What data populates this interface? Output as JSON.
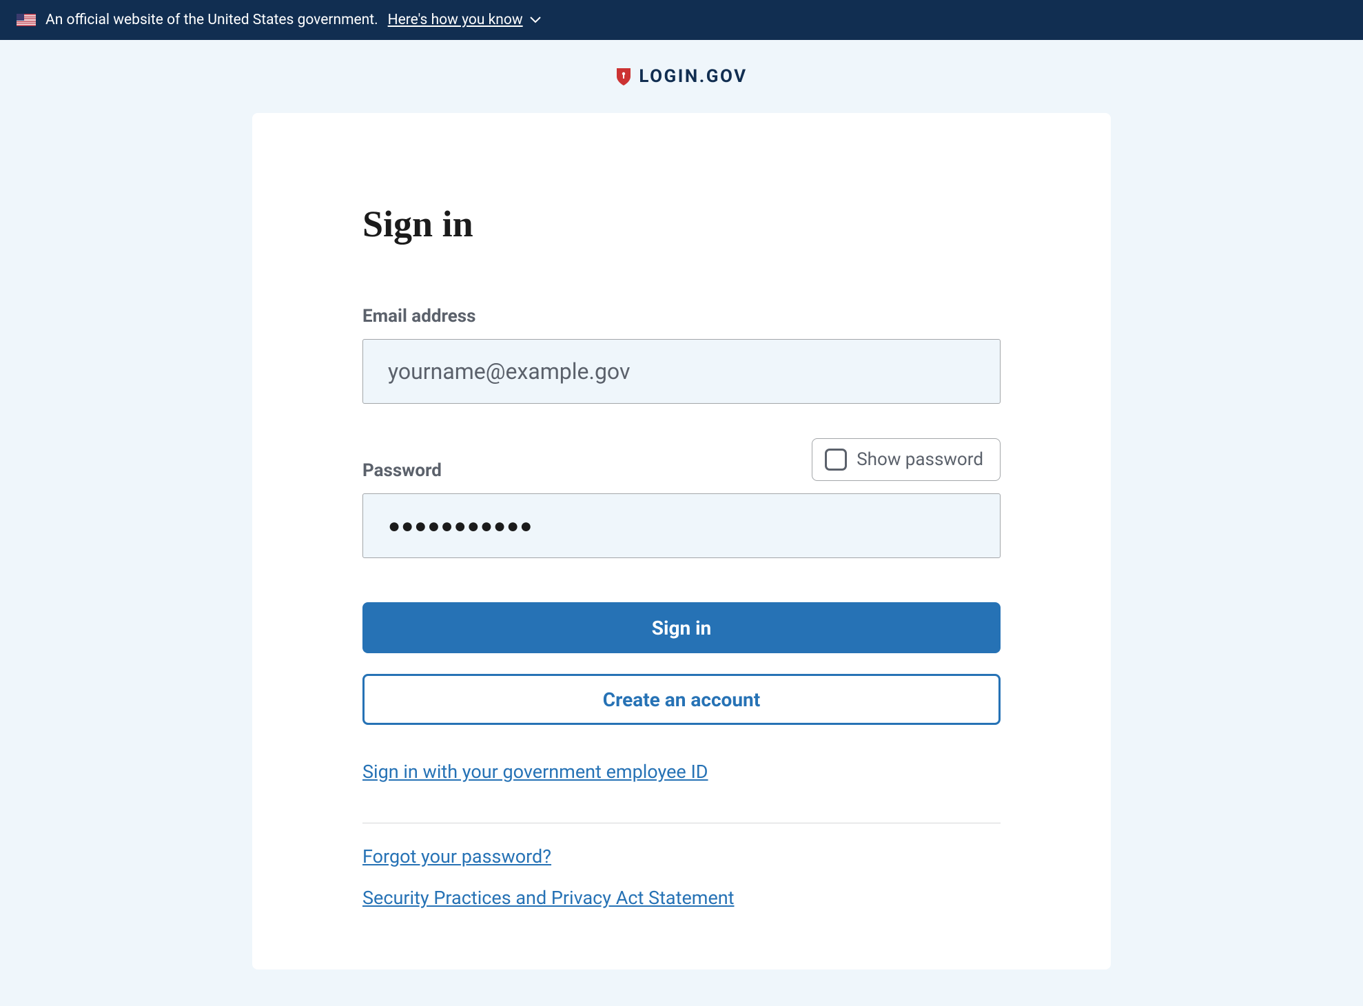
{
  "banner": {
    "text": "An official website of the United States government.",
    "link": "Here's how you know"
  },
  "logo": {
    "text": "LOGIN.GOV"
  },
  "form": {
    "title": "Sign in",
    "email_label": "Email address",
    "email_placeholder": "yourname@example.gov",
    "password_label": "Password",
    "password_value": "●●●●●●●●●●●",
    "show_password_label": "Show password",
    "signin_button": "Sign in",
    "create_account_button": "Create an account",
    "piv_link": "Sign in with your government employee ID",
    "forgot_link": "Forgot your password?",
    "privacy_link": "Security Practices and Privacy Act Statement"
  }
}
